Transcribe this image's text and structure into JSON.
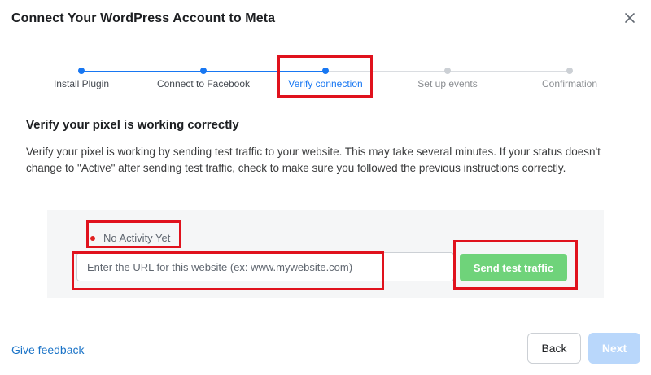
{
  "dialog": {
    "title": "Connect Your WordPress Account to Meta"
  },
  "stepper": {
    "steps": [
      {
        "label": "Install Plugin",
        "state": "done"
      },
      {
        "label": "Connect to Facebook",
        "state": "done"
      },
      {
        "label": "Verify connection",
        "state": "active"
      },
      {
        "label": "Set up events",
        "state": "pending"
      },
      {
        "label": "Confirmation",
        "state": "pending"
      }
    ]
  },
  "verify": {
    "heading": "Verify your pixel is working correctly",
    "description": "Verify your pixel is working by sending test traffic to your website. This may take several minutes. If your status doesn't change to \"Active\" after sending test traffic, check to make sure you followed the previous instructions correctly.",
    "status_text": "No Activity Yet",
    "url_value": "",
    "url_placeholder": "Enter the URL for this website (ex: www.mywebsite.com)",
    "send_label": "Send test traffic"
  },
  "footer": {
    "feedback_label": "Give feedback",
    "back_label": "Back",
    "next_label": "Next"
  },
  "colors": {
    "accent": "#1877f2",
    "send_button": "#6fd37a",
    "next_disabled": "#b9d7fb",
    "status_dot": "#e02020",
    "highlight": "#e0121d"
  }
}
